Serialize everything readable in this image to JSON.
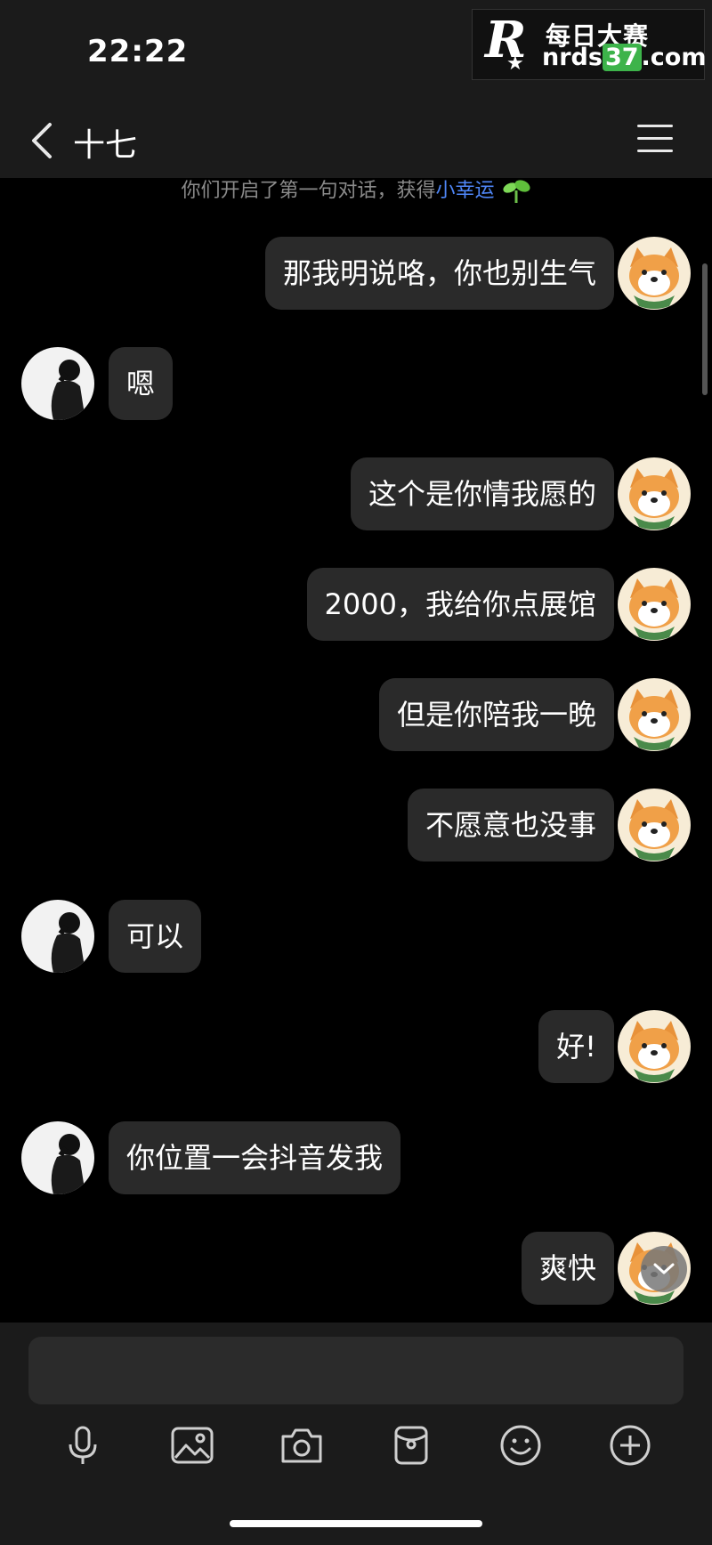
{
  "status": {
    "time": "22:22"
  },
  "watermark": {
    "logo": "R",
    "cn_text": "每日大赛",
    "url_pre": "nrds",
    "url_num": "37",
    "url_post": ".com"
  },
  "header": {
    "title": "十七"
  },
  "notice": {
    "text": "你们开启了第一句对话，获得",
    "highlight": "小幸运"
  },
  "messages": [
    {
      "side": "right",
      "text": "那我明说咯，你也别生气"
    },
    {
      "side": "left",
      "text": "嗯"
    },
    {
      "side": "right",
      "text": "这个是你情我愿的"
    },
    {
      "side": "right",
      "text": "2000，我给你点展馆"
    },
    {
      "side": "right",
      "text": "但是你陪我一晚"
    },
    {
      "side": "right",
      "text": "不愿意也没事"
    },
    {
      "side": "left",
      "text": "可以"
    },
    {
      "side": "right",
      "text": "好!"
    },
    {
      "side": "left",
      "text": "你位置一会抖音发我"
    },
    {
      "side": "right",
      "text": "爽快"
    }
  ],
  "composer": {
    "input_value": "",
    "tools": [
      "microphone-icon",
      "image-icon",
      "camera-icon",
      "red-packet-icon",
      "emoji-icon",
      "plus-icon"
    ]
  },
  "colors": {
    "bubble": "#2a2a2a",
    "highlight": "#4f86f7",
    "background": "#000000",
    "bar": "#1b1b1b"
  }
}
